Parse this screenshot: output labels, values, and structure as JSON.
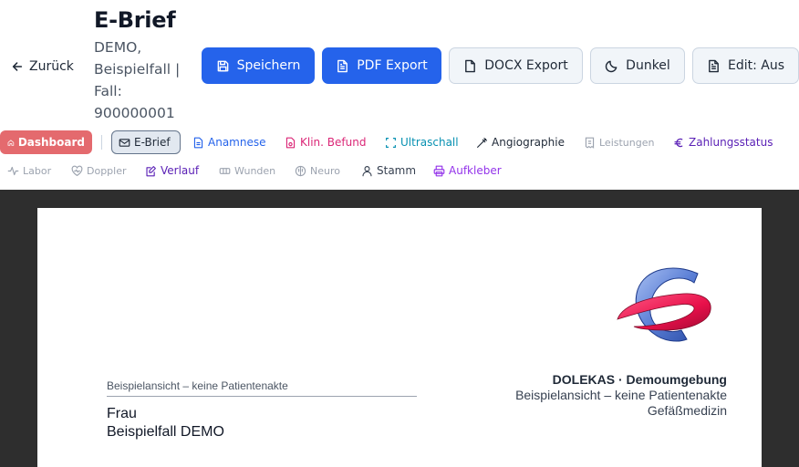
{
  "header": {
    "back_label": "Zurück",
    "title": "E-Brief",
    "subtitle": "DEMO, Beispielfall | Fall: 900000001"
  },
  "toolbar": {
    "save_label": "Speichern",
    "pdf_label": "PDF Export",
    "docx_label": "DOCX Export",
    "dark_label": "Dunkel",
    "edit_label": "Edit: Aus"
  },
  "nav": {
    "row1": [
      {
        "label": "Dashboard",
        "icon": "home-icon",
        "color": "#ffffff"
      },
      {
        "label": "E-Brief",
        "icon": "mail-icon",
        "color": "#1f2937"
      },
      {
        "label": "Anamnese",
        "icon": "document-icon",
        "color": "#2563eb"
      },
      {
        "label": "Klin. Befund",
        "icon": "file-stethoscope-icon",
        "color": "#db2777"
      },
      {
        "label": "Ultraschall",
        "icon": "scan-icon",
        "color": "#0891b2"
      },
      {
        "label": "Angiographie",
        "icon": "syringe-icon",
        "color": "#1f2937"
      },
      {
        "label": "Leistungen",
        "icon": "receipt-icon",
        "color": "#9ca3af"
      },
      {
        "label": "Zahlungsstatus",
        "icon": "euro-icon",
        "color": "#5b21b6"
      }
    ],
    "row2": [
      {
        "label": "Labor",
        "icon": "activity-icon",
        "color": "#9ca3af"
      },
      {
        "label": "Doppler",
        "icon": "heart-pulse-icon",
        "color": "#9ca3af"
      },
      {
        "label": "Verlauf",
        "icon": "edit-note-icon",
        "color": "#5b21b6"
      },
      {
        "label": "Wunden",
        "icon": "bandage-icon",
        "color": "#9ca3af"
      },
      {
        "label": "Neuro",
        "icon": "brain-icon",
        "color": "#9ca3af"
      },
      {
        "label": "Stamm",
        "icon": "user-icon",
        "color": "#374151"
      },
      {
        "label": "Aufkleber",
        "icon": "printer-icon",
        "color": "#9333ea"
      }
    ]
  },
  "letter": {
    "sender_line": "Beispielansicht – keine Patientenakte",
    "recipient_salutation": "Frau",
    "recipient_name": "Beispielfall DEMO",
    "org_name": "DOLEKAS · Demoumgebung",
    "org_subtitle": "Beispielansicht – keine Patientenakte",
    "org_department": "Gefäßmedizin"
  },
  "colors": {
    "primary": "#2563eb",
    "dashboard": "#e46a6e",
    "stage_bg": "#2e2e2e",
    "logo_blue": "#5b7fd6",
    "logo_pink": "#e8104a"
  }
}
